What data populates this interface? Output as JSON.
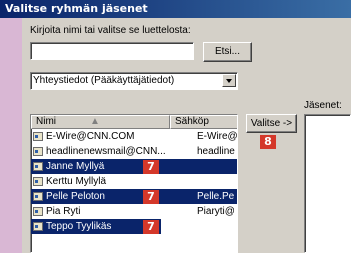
{
  "window": {
    "title": "Valitse ryhmän jäsenet"
  },
  "search": {
    "label": "Kirjoita nimi tai valitse se luettelosta:",
    "value": "",
    "find_button": "Etsi..."
  },
  "address_book": {
    "selected": "Yhteystiedot (Pääkäyttäjätiedot)"
  },
  "list": {
    "columns": [
      "Nimi",
      "Sähköp"
    ],
    "rows": [
      {
        "name": "E-Wire@CNN.COM",
        "email": "E-Wire@",
        "selected": false
      },
      {
        "name": "headlinenewsmail@CNN...",
        "email": "headline",
        "selected": false
      },
      {
        "name": "Janne Myllyä",
        "email": "",
        "selected": true
      },
      {
        "name": "Kerttu Myllylä",
        "email": "",
        "selected": false
      },
      {
        "name": "Pelle Peloton",
        "email": "Pelle.Pe",
        "selected": true
      },
      {
        "name": "Pia Ryti",
        "email": "Piaryti@",
        "selected": false
      },
      {
        "name": "Teppo Tyylikäs",
        "email": "",
        "selected": true
      }
    ]
  },
  "select_button": "Valitse ->",
  "members": {
    "label": "Jäsenet:"
  },
  "callouts": {
    "seven": "7",
    "eight": "8"
  }
}
